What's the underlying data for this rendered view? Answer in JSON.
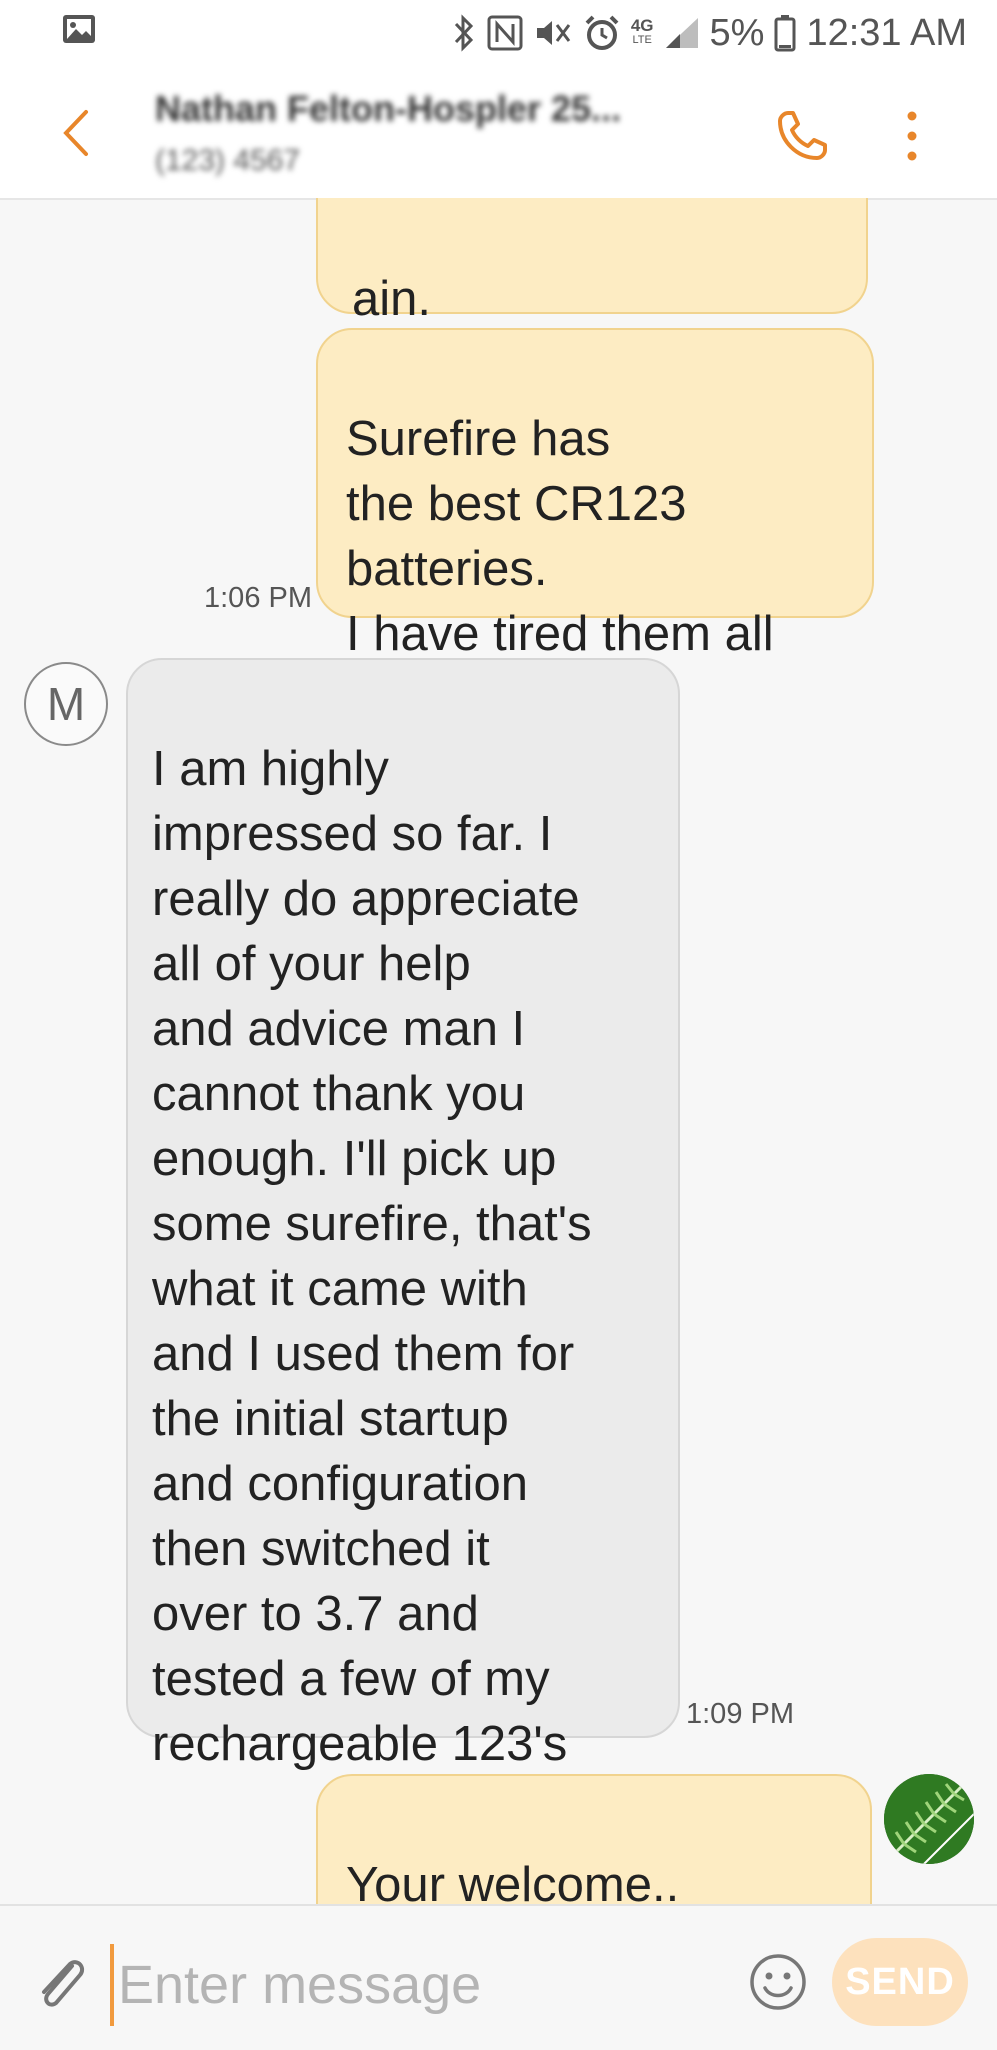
{
  "status_bar": {
    "gallery_icon": "image-icon",
    "icons": [
      "bluetooth-icon",
      "nfc-icon",
      "mute-icon",
      "alarm-icon",
      "4g-lte-icon",
      "signal-icon"
    ],
    "network_label": "4G",
    "network_sub": "LTE",
    "battery_percent": "5%",
    "time": "12:31 AM"
  },
  "header": {
    "contact_name": "Nathan Felton-Hospler 25...",
    "contact_number": "(123) 4567",
    "accent_color": "#e8862a"
  },
  "messages": [
    {
      "direction": "sent",
      "text": "ain.",
      "time": ""
    },
    {
      "direction": "sent",
      "text": "Surefire has\nthe best CR123\nbatteries.\nI have tired them all",
      "time": "1:06 PM"
    },
    {
      "direction": "received",
      "avatar_letter": "M",
      "text": "I am highly\nimpressed so far. I\nreally do appreciate\nall of your help\nand advice man I\ncannot thank you\nenough. I'll pick up\nsome surefire, that's\nwhat it came with\nand I used them for\nthe initial startup\nand configuration\nthen switched it\nover to 3.7 and\ntested a few of my\nrechargeable 123's",
      "time": "1:09 PM"
    },
    {
      "direction": "sent",
      "text": "Your welcome..\nI apologize again",
      "time": ""
    }
  ],
  "composer": {
    "placeholder": "Enter message",
    "send_label": "SEND"
  }
}
